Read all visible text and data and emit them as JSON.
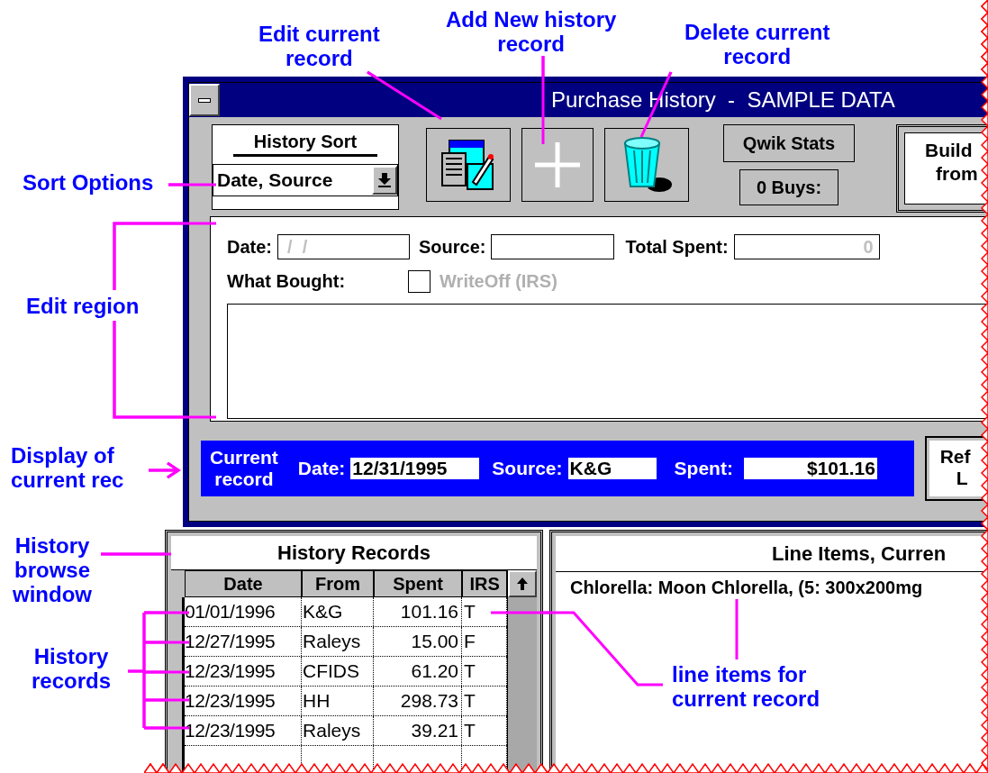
{
  "annotations": [
    {
      "lines": [
        "Edit current",
        "record"
      ]
    },
    {
      "lines": [
        "Add New history",
        "record"
      ]
    },
    {
      "lines": [
        "Delete current",
        "record"
      ]
    },
    {
      "lines": [
        "Sort Options"
      ]
    },
    {
      "lines": [
        "Edit region"
      ]
    },
    {
      "lines": [
        "Display of",
        "current rec"
      ]
    },
    {
      "lines": [
        "History",
        "browse",
        "window"
      ]
    },
    {
      "lines": [
        "History",
        "records"
      ]
    },
    {
      "lines": [
        "line items for",
        "current record"
      ]
    }
  ],
  "window": {
    "title": "Purchase History  -  SAMPLE DATA",
    "sort": {
      "title": "History Sort",
      "value": "Date, Source"
    },
    "toolbar_buttons": [
      {
        "kind": "edit"
      },
      {
        "kind": "add"
      },
      {
        "kind": "delete"
      }
    ],
    "qwik_stats": "Qwik Stats",
    "buys": "0 Buys:",
    "build": [
      "Build",
      "from"
    ],
    "edit_form": {
      "date_label": "Date:",
      "date_value": "/  /",
      "source_label": "Source:",
      "total_label": "Total Spent:",
      "total_value": "0",
      "what_bought_label": "What Bought:",
      "writeoff": {
        "label": "WriteOff (IRS)",
        "checked": false,
        "disabled": true
      }
    },
    "current": {
      "label": [
        "Current",
        "record"
      ],
      "date_label": "Date:",
      "date": "12/31/1995",
      "source_label": "Source:",
      "source": "K&G",
      "spent_label": "Spent:",
      "spent": "$101.16"
    },
    "refresh": [
      "Ref",
      "L"
    ]
  },
  "history": {
    "title": "History Records",
    "columns": [
      "Date",
      "From",
      "Spent",
      "IRS"
    ],
    "rows": [
      [
        "01/01/1996",
        "K&G",
        "101.16",
        "T"
      ],
      [
        "12/27/1995",
        "Raleys",
        "15.00",
        "F"
      ],
      [
        "12/23/1995",
        "CFIDS",
        "61.20",
        "T"
      ],
      [
        "12/23/1995",
        "HH",
        "298.73",
        "T"
      ],
      [
        "12/23/1995",
        "Raleys",
        "39.21",
        "T"
      ]
    ]
  },
  "line_items": {
    "title": "Line Items, Curren",
    "items": [
      "Chlorella: Moon Chlorella, (5: 300x200mg"
    ]
  }
}
